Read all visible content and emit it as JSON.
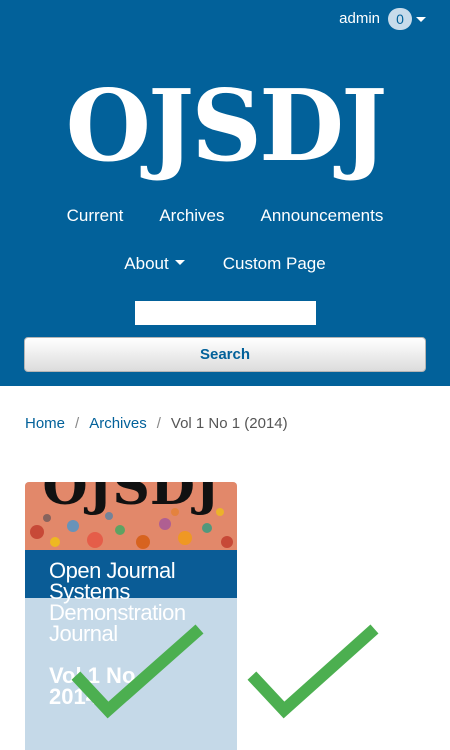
{
  "header": {
    "user": {
      "name": "admin",
      "notification_count": "0"
    },
    "logo_text": "OJSDJ",
    "nav": {
      "primary": [
        {
          "label": "Current"
        },
        {
          "label": "Archives"
        },
        {
          "label": "Announcements"
        }
      ],
      "secondary": [
        {
          "label": "About"
        },
        {
          "label": "Custom Page"
        }
      ]
    },
    "search": {
      "value": "",
      "button_label": "Search"
    }
  },
  "breadcrumb": {
    "home": "Home",
    "archives": "Archives",
    "current": "Vol 1 No 1 (2014)",
    "separator": "/"
  },
  "cover": {
    "masthead": "OJSDJ",
    "title": "Open Journal\nSystems\nDemonstration\nJournal",
    "volume": "Vol 1 No\n2014"
  },
  "colors": {
    "header_bg": "#02619a",
    "link": "#02619a",
    "check": "#4caf50"
  },
  "icons": {
    "notification": "badge",
    "dropdown": "chevron-down-icon",
    "checkmark": "checkmark-icon"
  }
}
